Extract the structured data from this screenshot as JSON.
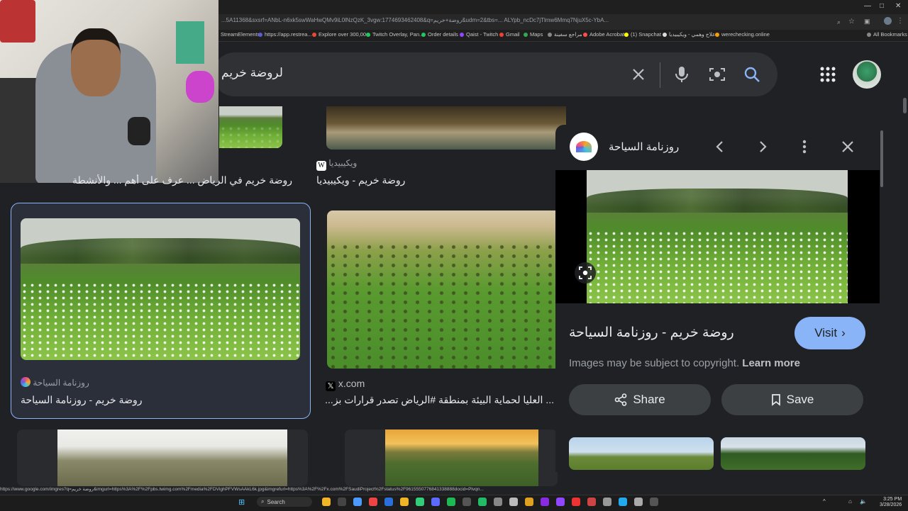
{
  "browser": {
    "url": "...5A11368&sxsrf=ANbL-n6xk5swWaHwQMv9iL0lNzQzK_3vgw:1774693462408&q=روضة+خريم&udm=2&tbs=... ALYpb_ncDc7jTlmw6Mmq7NjuX5c-YbA...",
    "bookmarks": [
      {
        "label": "StreamElements",
        "color": "#3b82f6"
      },
      {
        "label": "https://app.restrea...",
        "color": "#5b5bd6"
      },
      {
        "label": "Explore over 300,00...",
        "color": "#e84a3a"
      },
      {
        "label": "Twitch Overlay, Pan...",
        "color": "#22c55e"
      },
      {
        "label": "Order details",
        "color": "#22c55e"
      },
      {
        "label": "Qaist - Twitch",
        "color": "#9146ff"
      },
      {
        "label": "Gmail",
        "color": "#ea4335"
      },
      {
        "label": "Maps",
        "color": "#34a853"
      },
      {
        "label": "مراجع سفينة",
        "color": "#888888"
      },
      {
        "label": "Adobe Acrobat",
        "color": "#ff4d4d"
      },
      {
        "label": "(1) Snapchat",
        "color": "#fffc00"
      },
      {
        "label": "علاج وهمي - ويكيبيديا",
        "color": "#dddddd"
      },
      {
        "label": "werechecking.online",
        "color": "#f59e0b"
      },
      {
        "label": "All Bookmarks",
        "color": "#888888"
      }
    ]
  },
  "search": {
    "query": "لروضة خريم",
    "clear_icon": "close-icon",
    "voice_icon": "mic-icon",
    "lens_icon": "camera-lens-icon",
    "search_icon": "search-icon"
  },
  "results": [
    {
      "source": "ويكيبيديا",
      "caption": "روضة خريم - ويكيبيديا"
    },
    {
      "source": "",
      "caption": "روضة خريم في الرياض ... عرف على أهم ... والأنشطة"
    },
    {
      "source": "روزنامة السياحة",
      "caption": "روضة خريم - روزنامة السياحة"
    },
    {
      "source": "x.com",
      "caption": "... العليا لحماية البيئة بمنطقة #الرياض تصدر قرارات بز..."
    }
  ],
  "panel": {
    "site_name": "روزنامة السياحة",
    "title": "روضة خريم - روزنامة السياحة",
    "visit_label": "Visit",
    "copyright_text": "Images may be subject to copyright.",
    "learn_more": "Learn more",
    "share_label": "Share",
    "save_label": "Save"
  },
  "status_url": "https://www.google.com/imgres?q=روضة خريم&imgurl=https%3A%2F%2Fpbs.twimg.com%2Fmedia%2FDVighPFVWsAAkL6k.jpg&imgrefurl=https%3A%2F%2Fx.com%2FSaudiProject%2Fstatus%2F9615550776841338888docid=Plvqn...",
  "taskbar": {
    "search_label": "Search",
    "time": "3:25 PM",
    "date": "3/28/2026"
  }
}
